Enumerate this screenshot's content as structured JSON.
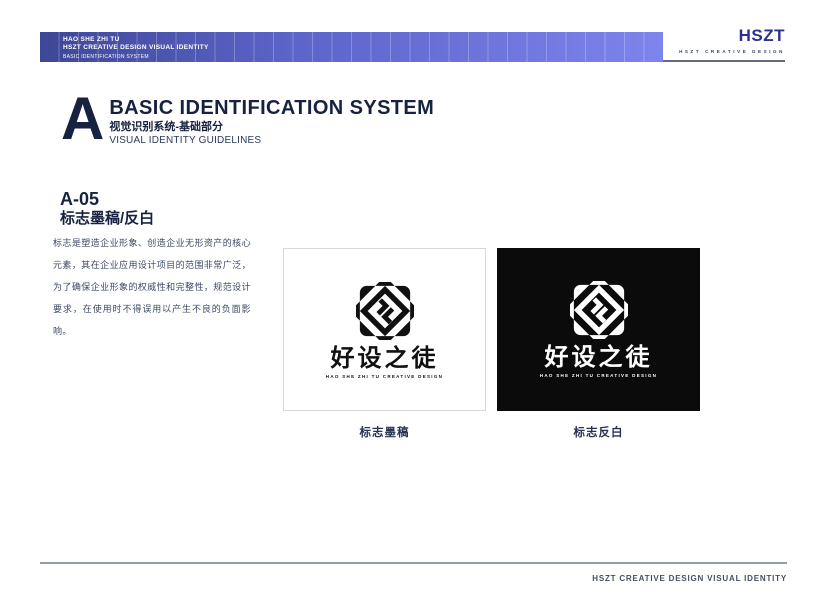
{
  "header": {
    "bar": {
      "line1": "HAO SHE ZHI TU",
      "line2": "HSZT CREATIVE DESIGN VISUAL IDENTITY",
      "line3": "BASIC IDENTIFICATION SYSTEM",
      "gradient_left": "#3e4795",
      "gradient_right": "#7d84ec"
    },
    "brand": {
      "wordmark": "HSZT",
      "tagline": "HSZT CREATIVE DESIGN",
      "wordmark_color": "#2b3193"
    }
  },
  "title_block": {
    "index_letter": "A",
    "title": "BASIC IDENTIFICATION SYSTEM",
    "subtitle_cn": "视觉识别系统-基础部分",
    "subtitle_en": "VISUAL IDENTITY GUIDELINES",
    "title_color": "#16223f"
  },
  "section": {
    "code": "A-05",
    "title": "标志墨稿/反白",
    "body": "标志是塑造企业形象、创造企业无形资产的核心元素，其在企业应用设计项目的范围非常广泛，为了确保企业形象的权威性和完整性，规范设计要求，在使用时不得误用以产生不良的负面影响。"
  },
  "specimens": {
    "ink": {
      "caption": "标志墨稿",
      "background": "#ffffff",
      "foreground": "#111111",
      "logo_cn": "好设之徒",
      "logo_en": "HAO SHE ZHI TU CREATIVE DESIGN"
    },
    "reversed": {
      "caption": "标志反白",
      "background": "#0b0b0b",
      "foreground": "#ffffff",
      "logo_cn": "好设之徒",
      "logo_en": "HAO SHE ZHI TU CREATIVE DESIGN"
    }
  },
  "footer": {
    "text": "HSZT CREATIVE DESIGN VISUAL IDENTITY"
  }
}
